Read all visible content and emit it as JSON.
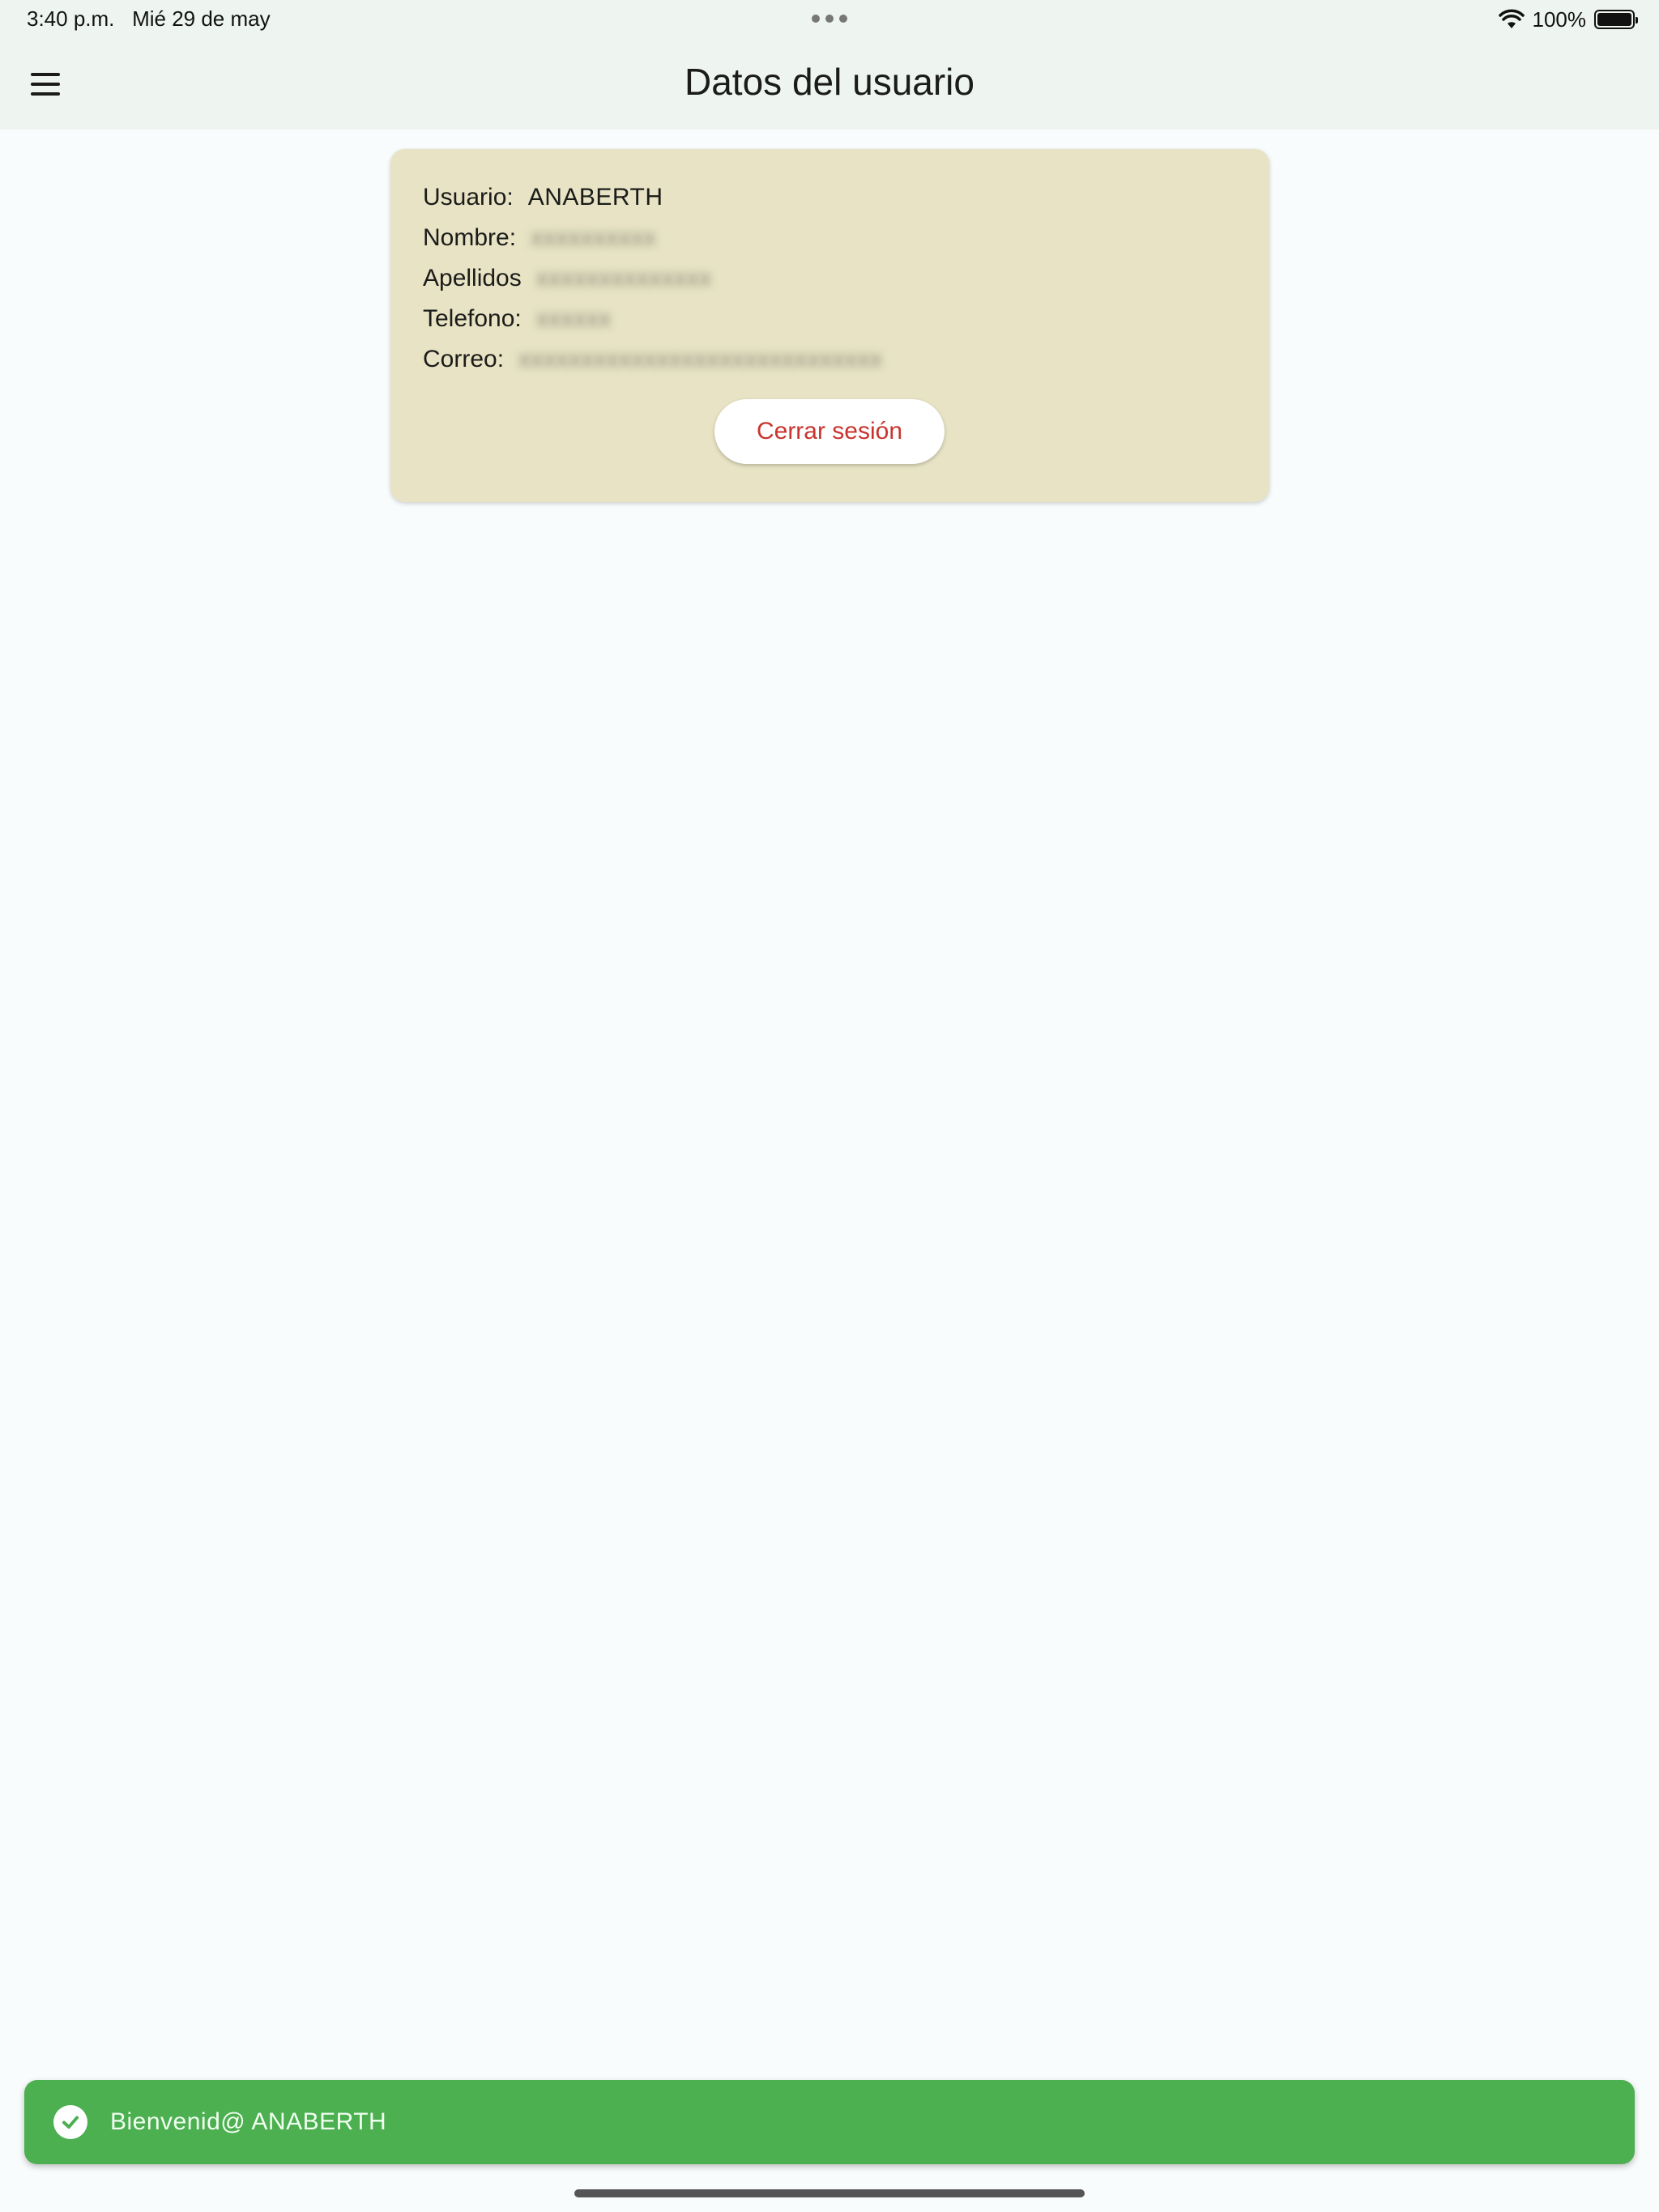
{
  "status_bar": {
    "time": "3:40 p.m.",
    "date": "Mié 29 de may",
    "battery": "100%",
    "wifi_icon": "wifi-icon",
    "battery_icon": "battery-icon"
  },
  "app_bar": {
    "title": "Datos del usuario",
    "menu_icon": "hamburger-menu-icon"
  },
  "user_card": {
    "background": "#e7e3c4",
    "rows": [
      {
        "label": "Usuario:",
        "value": "ANABERTH"
      },
      {
        "label": "Nombre:",
        "value": ""
      },
      {
        "label": "Apellidos",
        "value": ""
      },
      {
        "label": "Telefono:",
        "value": ""
      },
      {
        "label": "Correo:",
        "value": ""
      }
    ],
    "logout_label": "Cerrar sesión",
    "logout_color": "#c9342e"
  },
  "snackbar": {
    "message": "Bienvenid@ ANABERTH",
    "icon": "check-circle-icon",
    "background": "#4caf50"
  }
}
